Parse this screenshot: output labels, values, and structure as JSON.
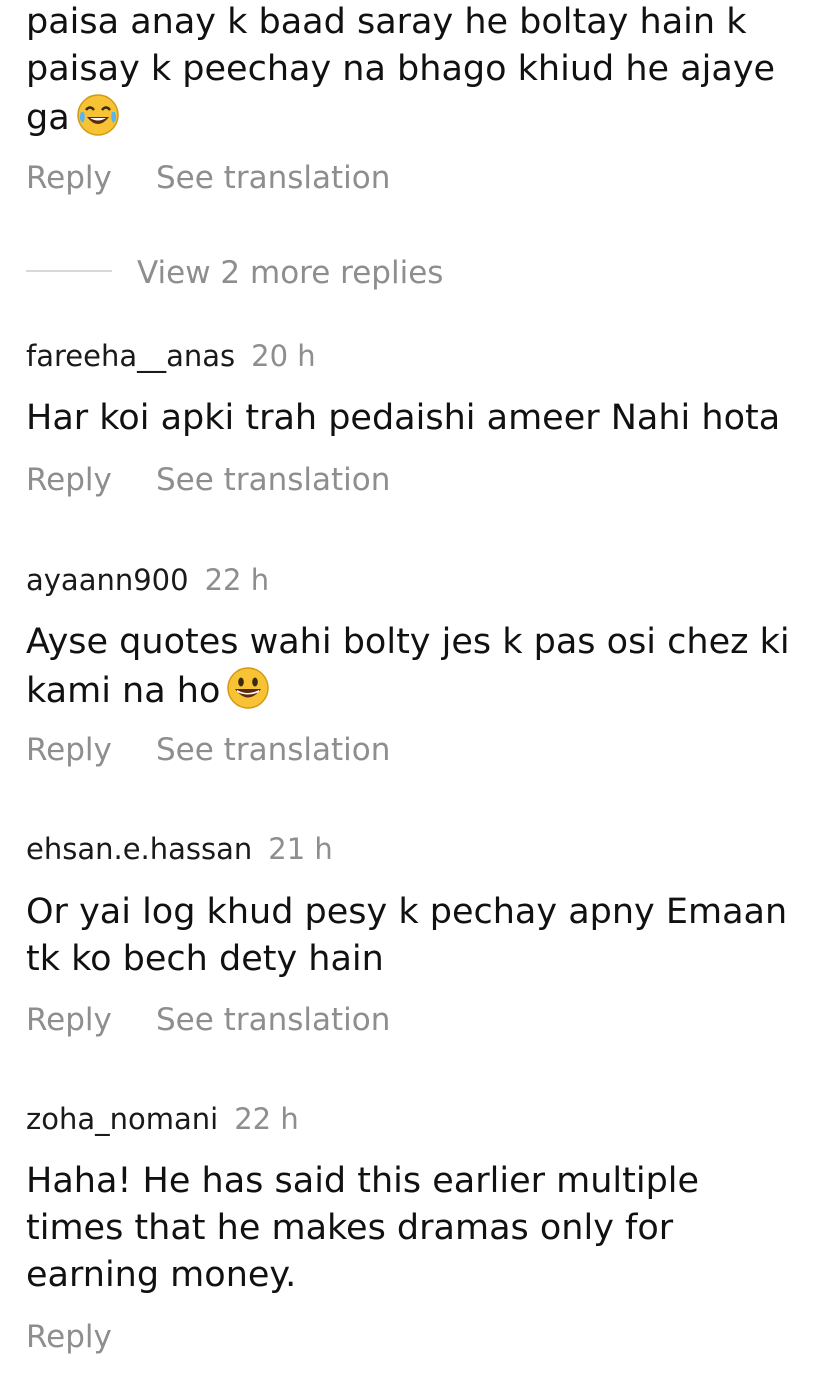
{
  "comments": [
    {
      "username": "",
      "time": "",
      "lines": [
        "paisa anay k baad saray he boltay hain k",
        "paisay k peechay na bhago khiud he ajaye",
        "ga"
      ],
      "emoji": "laughing-tears-emoji",
      "reply_label": "Reply",
      "translate_label": "See translation"
    },
    {
      "username": "fareeha__anas",
      "time": "20 h",
      "lines": [
        "Har koi apki trah pedaishi ameer Nahi hota"
      ],
      "reply_label": "Reply",
      "translate_label": "See translation"
    },
    {
      "username": "ayaann900",
      "time": "22 h",
      "lines": [
        "Ayse quotes wahi bolty jes k pas osi chez ki",
        "kami na ho"
      ],
      "emoji": "grinning-emoji",
      "reply_label": "Reply",
      "translate_label": "See translation"
    },
    {
      "username": "ehsan.e.hassan",
      "time": "21 h",
      "lines": [
        "Or yai log khud pesy k pechay apny Emaan",
        "tk ko bech dety hain"
      ],
      "reply_label": "Reply",
      "translate_label": "See translation"
    },
    {
      "username": "zoha_nomani",
      "time": "22 h",
      "lines": [
        "Haha! He has said this earlier multiple",
        "times that he makes dramas only for",
        "earning money."
      ],
      "reply_label": "Reply"
    }
  ],
  "view_more": {
    "label": "View 2 more replies"
  }
}
